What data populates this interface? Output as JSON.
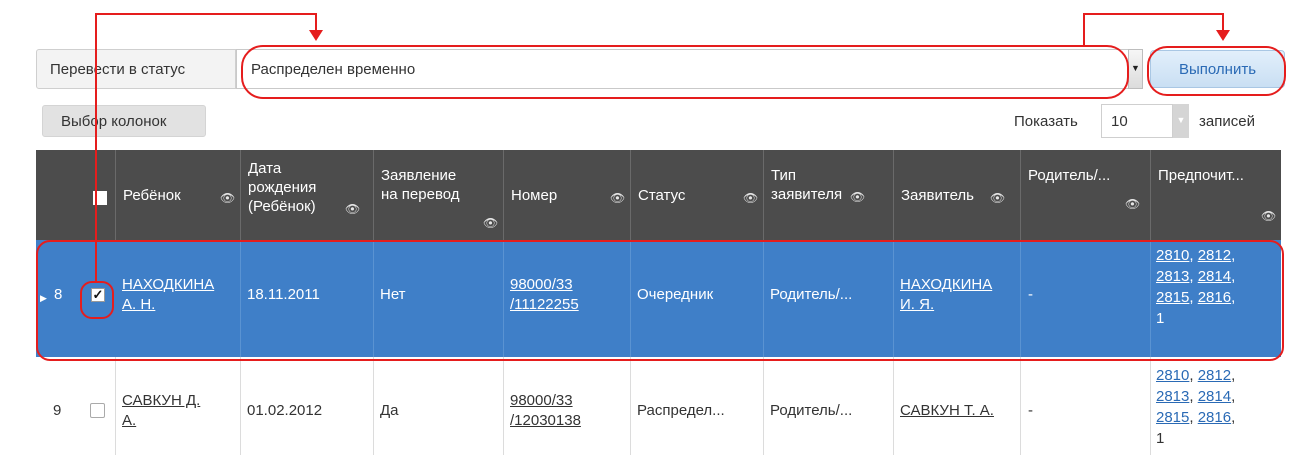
{
  "toolbar": {
    "status_label": "Перевести в статус",
    "status_value": "Распределен временно",
    "execute_label": "Выполнить",
    "columns_label": "Выбор колонок",
    "show_label": "Показать",
    "show_value": "10",
    "records_label": "записей"
  },
  "table": {
    "headers": {
      "child": "Ребёнок",
      "birth_l1": "Дата",
      "birth_l2": "рождения",
      "birth_l3": "(Ребёнок)",
      "transfer_l1": "Заявление",
      "transfer_l2": "на перевод",
      "number": "Номер",
      "status": "Статус",
      "type_l1": "Тип",
      "type_l2": "заявителя",
      "applicant": "Заявитель",
      "parent": "Родитель/...",
      "preferred": "Предпочит..."
    },
    "rows": [
      {
        "index": "8",
        "checked": true,
        "child_l1": "НАХОДКИНА",
        "child_l2": "А. Н.",
        "birth": "18.11.2011",
        "transfer": "Нет",
        "number_l1": "98000/33",
        "number_l2": "/11122255",
        "status": "Очередник",
        "type": "Родитель/...",
        "applicant_l1": "НАХОДКИНА",
        "applicant_l2": "И. Я.",
        "parent": "-",
        "pref": [
          "2810",
          "2812",
          "2813",
          "2814",
          "2815",
          "2816",
          "1"
        ]
      },
      {
        "index": "9",
        "checked": false,
        "child_l1": "САВКУН Д.",
        "child_l2": "А.",
        "birth": "01.02.2012",
        "transfer": "Да",
        "number_l1": "98000/33",
        "number_l2": "/12030138",
        "status": "Распредел...",
        "type": "Родитель/...",
        "applicant_l1": "САВКУН Т. А.",
        "parent": "-",
        "pref": [
          "2810",
          "2812",
          "2813",
          "2814",
          "2815",
          "2816",
          "1"
        ]
      }
    ]
  },
  "colors": {
    "header_bg": "#4c4c4c",
    "selected_row_bg": "#3f7fc8",
    "link": "#2a6ab5",
    "annotation": "#e51d1d"
  }
}
